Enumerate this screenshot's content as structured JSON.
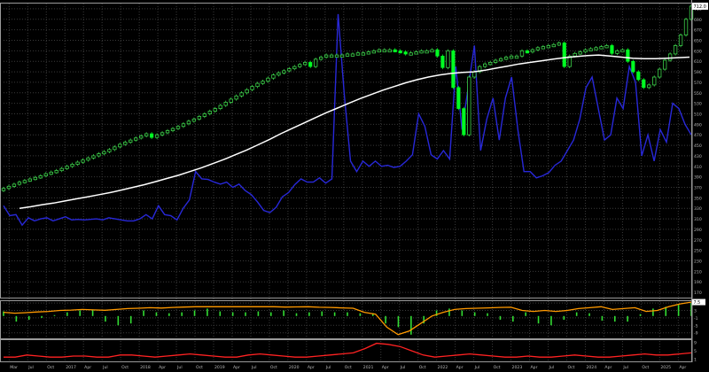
{
  "colors": {
    "background": "#000000",
    "grid": "#3a3a3a",
    "panel_border": "#9a9a9a",
    "axis_text": "#b8b8b8",
    "candle_up": "#3cd04a",
    "candle_down": "#00ff22",
    "moving_average": "#ffffff",
    "volume_line": "#2828d8",
    "osc_line": "#ff9900",
    "osc_bars": "#33dd33",
    "bottom_line": "#ff2222",
    "last_price_tag": "#ffffff"
  },
  "chart_data": [
    {
      "type": "candlestick",
      "panel": "price",
      "ylim": [
        160,
        720
      ],
      "y_ticks": [
        170,
        190,
        210,
        230,
        250,
        270,
        290,
        310,
        330,
        350,
        370,
        390,
        410,
        430,
        450,
        470,
        490,
        510,
        530,
        550,
        570,
        590,
        610,
        630,
        650,
        670,
        690,
        710
      ],
      "x_labels": [
        "Mar",
        "Jul",
        "Oct",
        "2017",
        "Apr",
        "Jul",
        "Oct",
        "2018",
        "Apr",
        "Jul",
        "Oct",
        "2019",
        "Apr",
        "Jul",
        "Oct",
        "2020",
        "Apr",
        "Jul",
        "Oct",
        "2021",
        "Apr",
        "Jul",
        "Oct",
        "2022",
        "Apr",
        "Jul",
        "Oct",
        "2023",
        "Apr",
        "Jul",
        "Oct",
        "2024",
        "Apr",
        "Jul",
        "Oct",
        "2025",
        "Apr"
      ],
      "close_values": [
        368,
        372,
        376,
        380,
        383,
        386,
        389,
        392,
        396,
        399,
        402,
        406,
        410,
        414,
        418,
        422,
        426,
        430,
        434,
        438,
        442,
        447,
        452,
        456,
        460,
        464,
        468,
        472,
        465,
        470,
        474,
        478,
        482,
        486,
        491,
        496,
        500,
        505,
        510,
        515,
        520,
        526,
        532,
        538,
        544,
        550,
        556,
        562,
        568,
        572,
        578,
        584,
        588,
        592,
        596,
        600,
        604,
        608,
        600,
        614,
        618,
        622,
        622,
        622,
        622,
        624,
        624,
        626,
        626,
        628,
        630,
        632,
        632,
        632,
        630,
        628,
        624,
        626,
        628,
        630,
        630,
        632,
        620,
        598,
        630,
        560,
        520,
        470,
        580,
        590,
        600,
        605,
        608,
        612,
        615,
        618,
        620,
        620,
        630,
        628,
        632,
        636,
        638,
        640,
        642,
        645,
        600,
        620,
        625,
        628,
        632,
        634,
        636,
        638,
        640,
        625,
        630,
        632,
        610,
        590,
        575,
        560,
        565,
        580,
        595,
        612,
        624,
        640,
        660,
        690,
        715
      ],
      "moving_average": [
        330,
        333,
        337,
        340,
        344,
        348,
        352,
        356,
        360,
        365,
        370,
        375,
        381,
        387,
        393,
        400,
        407,
        415,
        423,
        432,
        441,
        451,
        461,
        472,
        482,
        492,
        502,
        512,
        521,
        530,
        539,
        547,
        555,
        562,
        569,
        575,
        580,
        584,
        587,
        589,
        590,
        593,
        597,
        601,
        605,
        608,
        611,
        614,
        617,
        619,
        621,
        622,
        620,
        618,
        616,
        615,
        615,
        616,
        617,
        618
      ],
      "last_price_label": "712.0"
    },
    {
      "type": "line",
      "panel": "price",
      "name": "",
      "values": [
        335,
        316,
        318,
        298,
        312,
        306,
        310,
        312,
        306,
        310,
        314,
        308,
        309,
        308,
        309,
        310,
        308,
        312,
        310,
        308,
        306,
        306,
        310,
        318,
        310,
        335,
        318,
        316,
        308,
        330,
        346,
        400,
        386,
        385,
        380,
        376,
        380,
        370,
        376,
        364,
        356,
        342,
        326,
        322,
        332,
        352,
        360,
        375,
        386,
        380,
        380,
        388,
        378,
        386,
        700,
        546,
        420,
        400,
        420,
        410,
        420,
        410,
        412,
        408,
        410,
        420,
        432,
        510,
        486,
        432,
        424,
        440,
        424,
        600,
        480,
        560,
        640,
        440,
        500,
        540,
        460,
        540,
        580,
        480,
        400,
        400,
        388,
        392,
        398,
        412,
        420,
        440,
        460,
        500,
        560,
        580,
        520,
        460,
        470,
        540,
        520,
        600,
        570,
        430,
        470,
        420,
        480,
        456,
        530,
        520,
        490,
        470
      ],
      "line_color": "#2828d8"
    },
    {
      "type": "line_bar",
      "panel": "oscillator",
      "ylim": [
        -12,
        8
      ],
      "y_ticks": [
        7,
        3,
        -1,
        -5,
        -9
      ],
      "line_values": [
        2,
        1.5,
        1.8,
        2.2,
        2.5,
        3,
        3.2,
        3.5,
        3.3,
        3.1,
        3.5,
        4,
        4.2,
        4.5,
        4.3,
        4.6,
        4.8,
        5,
        5,
        5,
        5,
        5,
        5,
        5,
        5,
        4.8,
        4.9,
        5,
        4.7,
        4.6,
        4.4,
        4.2,
        2,
        1,
        -6,
        -10,
        -8,
        -4,
        0,
        2,
        3.5,
        4,
        4.2,
        4.4,
        4.6,
        4.7,
        3,
        2.5,
        3,
        2.5,
        3,
        4,
        4.5,
        5,
        3.5,
        4,
        4.5,
        2.5,
        3,
        5,
        6.5,
        7.5
      ],
      "bar_values": [
        2.5,
        -3,
        -2,
        -1,
        0.5,
        2,
        3,
        3.5,
        -3,
        -5,
        -4,
        3,
        2,
        1.5,
        2,
        3,
        4,
        2.5,
        2,
        2,
        2.5,
        2,
        3,
        1.5,
        2,
        2.5,
        2,
        2,
        1.5,
        1.5,
        -4,
        -6,
        -10,
        -4,
        3,
        4,
        3,
        2,
        1.5,
        -2,
        -3,
        2,
        -4,
        -5,
        -2,
        2,
        1.5,
        -2.5,
        -3,
        -3,
        1,
        4,
        5,
        6,
        7
      ],
      "last_value_label": "7.5"
    },
    {
      "type": "line",
      "panel": "bottom",
      "ylim": [
        0,
        10
      ],
      "y_ticks": [
        9,
        5,
        1
      ],
      "values": [
        2,
        2,
        3,
        2.5,
        2,
        2,
        2.5,
        2.5,
        2,
        2,
        3,
        3,
        2.5,
        2,
        2.5,
        3,
        3.5,
        3,
        2.5,
        2,
        2,
        3,
        3.5,
        3,
        2.5,
        2,
        2,
        2.5,
        3,
        3.5,
        4,
        6,
        8.5,
        8,
        7,
        5,
        3,
        2,
        2.5,
        3,
        3.5,
        3,
        2.5,
        2,
        2,
        2.5,
        2,
        2,
        2.5,
        3,
        2.5,
        2,
        2,
        2.5,
        3,
        3.5,
        3,
        3,
        3.5,
        4
      ],
      "line_color": "#ff2222"
    }
  ]
}
